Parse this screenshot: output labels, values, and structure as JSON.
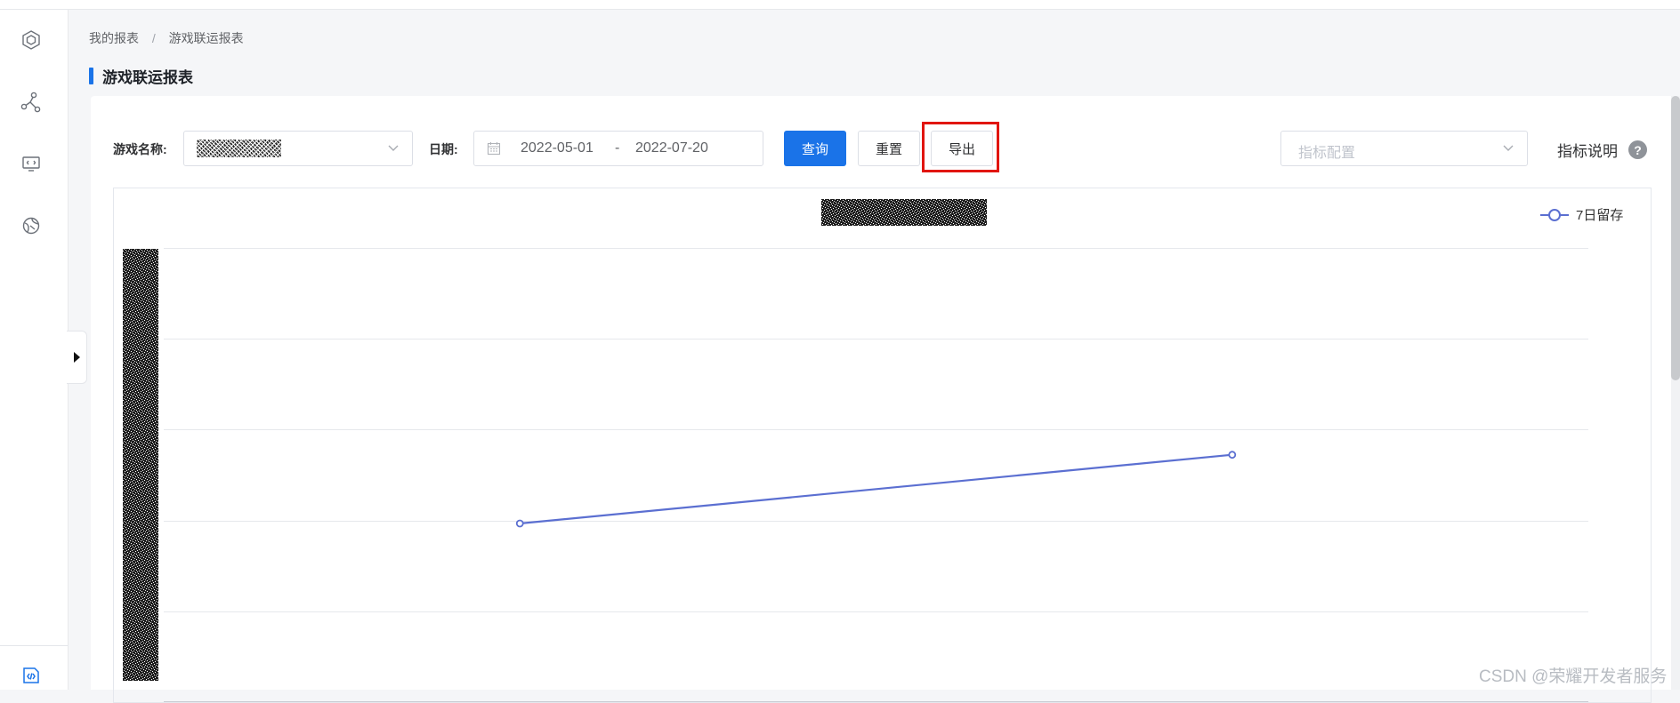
{
  "breadcrumb": {
    "parent": "我的报表",
    "separator": "/",
    "current": "游戏联运报表"
  },
  "page_title": "游戏联运报表",
  "filters": {
    "game_name_label": "游戏名称:",
    "date_label": "日期:",
    "start_date": "2022-05-01",
    "date_separator": "-",
    "end_date": "2022-07-20"
  },
  "toolbar": {
    "query_label": "查询",
    "reset_label": "重置",
    "export_label": "导出"
  },
  "metric_config": {
    "placeholder": "指标配置"
  },
  "metric_help_label": "指标说明",
  "help_glyph": "?",
  "watermark": "CSDN @荣耀开发者服务",
  "colors": {
    "primary": "#1a73e8",
    "series": "#5b6fd1",
    "highlight": "#e1150f"
  },
  "icons": [
    "cube-icon",
    "share-nodes-icon",
    "code-screen-icon",
    "globe-icon",
    "code-doc-icon",
    "caret-right-icon",
    "calendar-icon",
    "chevron-down-icon"
  ],
  "chart_data": {
    "type": "line",
    "legend": {
      "placement": "top-right",
      "entries": [
        "7日留存"
      ]
    },
    "grid": true,
    "series": [
      {
        "name": "7日留存",
        "color": "#5b6fd1",
        "values": [
          0.59,
          0.817
        ]
      }
    ],
    "ylim": [
      0,
      1.5
    ]
  }
}
